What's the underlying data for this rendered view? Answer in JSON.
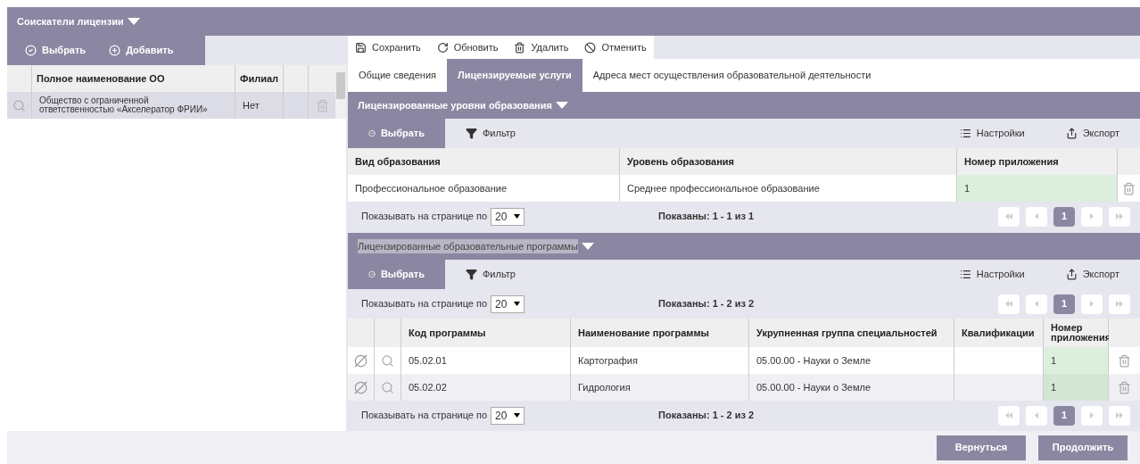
{
  "header": {
    "title": "Соискатели лицензии"
  },
  "left": {
    "toolbar": [
      {
        "label": "Выбрать",
        "kind": "select"
      },
      {
        "label": "Добавить",
        "kind": "add"
      }
    ],
    "columns": [
      "Полное наименование ОО",
      "Филиал"
    ],
    "rows": [
      {
        "name": "Общество с ограниченной ответственностью «Акселератор ФРИИ»",
        "branch": "Нет",
        "selected": true
      }
    ]
  },
  "actions": [
    {
      "label": "Сохранить",
      "kind": "save"
    },
    {
      "label": "Обновить",
      "kind": "refresh"
    },
    {
      "label": "Удалить",
      "kind": "delete"
    },
    {
      "label": "Отменить",
      "kind": "cancel"
    }
  ],
  "tabs": [
    {
      "label": "Общие сведения",
      "selected": false
    },
    {
      "label": "Лицензируемые услуги",
      "selected": true
    },
    {
      "label": "Адреса мест осуществления образовательной деятельности",
      "selected": false
    }
  ],
  "sections": [
    {
      "title": "Лицензированные уровни образования",
      "highlighted": false,
      "toolbar": [
        {
          "label": "Выбрать",
          "kind": "select"
        },
        {
          "label": "Фильтр",
          "kind": "filter"
        },
        {
          "label": "Настройки",
          "kind": "settings"
        },
        {
          "label": "Экспорт",
          "kind": "export"
        }
      ],
      "row_icons": false,
      "columns": [
        {
          "label": "Вид образования",
          "kind": "text"
        },
        {
          "label": "Уровень образования",
          "kind": "text"
        },
        {
          "label": "Номер приложения",
          "kind": "number"
        }
      ],
      "rows": [
        {
          "cells": [
            "Профессиональное образование",
            "Среднее профессиональное образование",
            "1"
          ]
        }
      ],
      "pager_bottom": {
        "per_page_label": "Показывать на странице по",
        "per_page": "20",
        "shown": "Показаны: 1 - 1 из 1",
        "pages": [
          {
            "label": "1",
            "selected": true
          }
        ]
      }
    },
    {
      "title": "Лицензированные образовательные программы",
      "highlighted": true,
      "toolbar": [
        {
          "label": "Выбрать",
          "kind": "select"
        },
        {
          "label": "Фильтр",
          "kind": "filter"
        },
        {
          "label": "Настройки",
          "kind": "settings"
        },
        {
          "label": "Экспорт",
          "kind": "export"
        }
      ],
      "row_icons": true,
      "columns": [
        {
          "label": "Код программы",
          "kind": "text"
        },
        {
          "label": "Наименование программы",
          "kind": "text"
        },
        {
          "label": "Укрупненная группа специальностей",
          "kind": "text"
        },
        {
          "label": "Квалификации",
          "kind": "text"
        },
        {
          "label": "Номер приложения",
          "kind": "number"
        }
      ],
      "rows": [
        {
          "cells": [
            "05.02.01",
            "Картография",
            "05.00.00 - Науки о Земле",
            "",
            "1"
          ]
        },
        {
          "cells": [
            "05.02.02",
            "Гидрология",
            "05.00.00 - Науки о Земле",
            "",
            "1"
          ]
        }
      ],
      "pager_top": {
        "per_page_label": "Показывать на странице по",
        "per_page": "20",
        "shown": "Показаны: 1 - 2 из 2",
        "pages": [
          {
            "label": "1",
            "selected": true
          }
        ]
      },
      "pager_bottom": {
        "per_page_label": "Показывать на странице по",
        "per_page": "20",
        "shown": "Показаны: 1 - 2 из 2",
        "pages": [
          {
            "label": "1",
            "selected": true
          }
        ]
      }
    }
  ],
  "footer": [
    {
      "label": "Вернуться"
    },
    {
      "label": "Продолжить"
    }
  ]
}
